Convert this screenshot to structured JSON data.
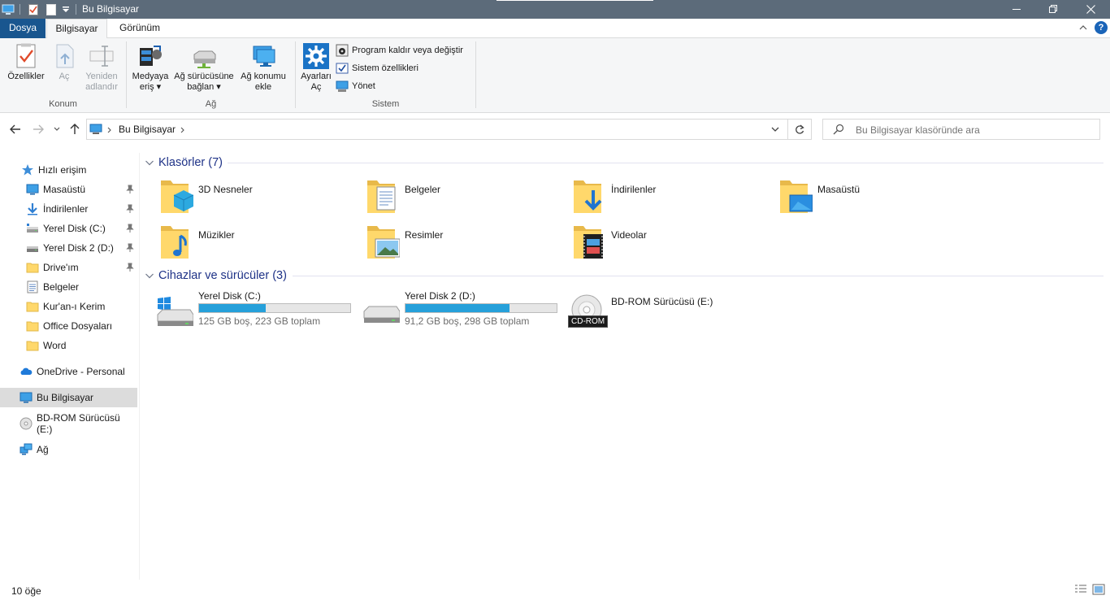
{
  "window": {
    "title": "Bu Bilgisayar",
    "controls": [
      "minimize",
      "restore",
      "close"
    ]
  },
  "ribbon": {
    "tabs": [
      {
        "label": "Dosya",
        "active": false
      },
      {
        "label": "Bilgisayar",
        "active": true
      },
      {
        "label": "Görünüm",
        "active": false
      }
    ],
    "groups": {
      "konum": {
        "label": "Konum",
        "buttons": [
          {
            "label": "Özellikler",
            "enabled": true
          },
          {
            "label": "Aç",
            "enabled": false
          },
          {
            "label_line1": "Yeniden",
            "label_line2": "adlandır",
            "enabled": false
          }
        ]
      },
      "ag": {
        "label": "Ağ",
        "buttons": [
          {
            "label_line1": "Medyaya",
            "label_line2": "eriş ▾"
          },
          {
            "label_line1": "Ağ sürücüsüne",
            "label_line2": "bağlan ▾"
          },
          {
            "label_line1": "Ağ konumu",
            "label_line2": "ekle"
          }
        ]
      },
      "sistem": {
        "label": "Sistem",
        "big_button": {
          "label_line1": "Ayarları",
          "label_line2": "Aç"
        },
        "small_buttons": [
          {
            "label": "Program kaldır veya değiştir"
          },
          {
            "label": "Sistem özellikleri"
          },
          {
            "label": "Yönet"
          }
        ]
      }
    }
  },
  "address": {
    "breadcrumb": "Bu Bilgisayar",
    "search_placeholder": "Bu Bilgisayar klasöründe ara"
  },
  "sidebar": {
    "quick_access": "Hızlı erişim",
    "items": [
      {
        "label": "Masaüstü",
        "icon": "desktop-icon",
        "pinned": true
      },
      {
        "label": "İndirilenler",
        "icon": "download-icon",
        "pinned": true
      },
      {
        "label": "Yerel Disk (C:)",
        "icon": "drive-icon",
        "pinned": true
      },
      {
        "label": "Yerel Disk 2 (D:)",
        "icon": "drive-icon",
        "pinned": true
      },
      {
        "label": "Drive'ım",
        "icon": "folder-icon",
        "pinned": true
      },
      {
        "label": "Belgeler",
        "icon": "documents-icon",
        "pinned": false
      },
      {
        "label": "Kur'an-ı Kerim",
        "icon": "folder-icon",
        "pinned": false
      },
      {
        "label": "Office Dosyaları",
        "icon": "folder-icon",
        "pinned": false
      },
      {
        "label": "Word",
        "icon": "folder-icon",
        "pinned": false
      }
    ],
    "onedrive": "OneDrive - Personal",
    "this_pc": "Bu Bilgisayar",
    "bdrom": "BD-ROM Sürücüsü (E:)",
    "network": "Ağ"
  },
  "content": {
    "folders_header": "Klasörler (7)",
    "folders": [
      {
        "name": "3D Nesneler",
        "icon": "3d-objects-folder-icon"
      },
      {
        "name": "Belgeler",
        "icon": "documents-folder-icon"
      },
      {
        "name": "İndirilenler",
        "icon": "downloads-folder-icon"
      },
      {
        "name": "Masaüstü",
        "icon": "desktop-folder-icon"
      },
      {
        "name": "Müzikler",
        "icon": "music-folder-icon"
      },
      {
        "name": "Resimler",
        "icon": "pictures-folder-icon"
      },
      {
        "name": "Videolar",
        "icon": "videos-folder-icon"
      }
    ],
    "devices_header": "Cihazlar ve sürücüler (3)",
    "drives": [
      {
        "name": "Yerel Disk (C:)",
        "info": "125 GB boş, 223 GB toplam",
        "used_fraction": 0.44
      },
      {
        "name": "Yerel Disk 2 (D:)",
        "info": "91,2 GB boş, 298 GB toplam",
        "used_fraction": 0.69
      },
      {
        "name": "BD-ROM Sürücüsü (E:)",
        "badge": "CD-ROM"
      }
    ]
  },
  "status": {
    "item_count": "10 öğe"
  },
  "colors": {
    "titlebar": "#5c6b7a",
    "file_tab": "#19568f",
    "group_header": "#1e3287",
    "drive_bar": "#26a0da",
    "selection": "#dcdcdc"
  }
}
